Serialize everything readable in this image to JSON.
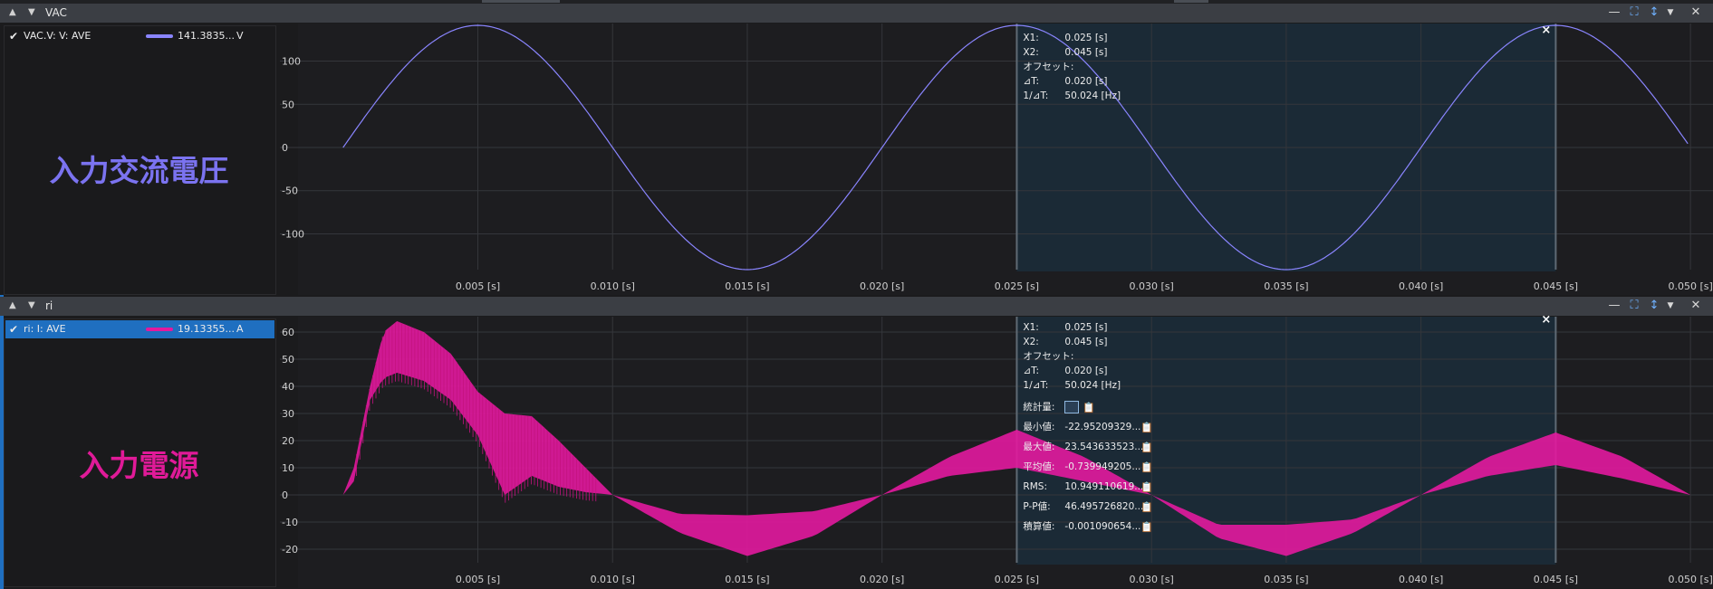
{
  "panels": [
    {
      "title": "VAC",
      "legend": {
        "name": "VAC.V: V: AVE",
        "value": "141.3835...",
        "unit": "V",
        "color": "#8a85ff",
        "selected": false
      },
      "annotation": {
        "text": "入力交流電圧",
        "color": "#7b73f0"
      },
      "cursor": {
        "close": "×",
        "rows": [
          {
            "label": "X1:",
            "value": "0.025 [s]"
          },
          {
            "label": "X2:",
            "value": "0.045 [s]"
          },
          {
            "label": "オフセット:",
            "value": ""
          },
          {
            "label": "⊿T:",
            "value": "0.020 [s]"
          },
          {
            "label": "1/⊿T:",
            "value": "50.024 [Hz]"
          }
        ]
      }
    },
    {
      "title": "ri",
      "legend": {
        "name": "ri: I: AVE",
        "value": "19.13355...",
        "unit": "A",
        "color": "#e3199e",
        "selected": true
      },
      "annotation": {
        "text": "入力電源",
        "color": "#e01a98"
      },
      "cursor": {
        "close": "×",
        "rows": [
          {
            "label": "X1:",
            "value": "0.025 [s]"
          },
          {
            "label": "X2:",
            "value": "0.045 [s]"
          },
          {
            "label": "オフセット:",
            "value": ""
          },
          {
            "label": "⊿T:",
            "value": "0.020 [s]"
          },
          {
            "label": "1/⊿T:",
            "value": "50.024 [Hz]"
          }
        ],
        "stats_label": "統計量:",
        "stats": [
          {
            "label": "最小値:",
            "value": "-22.95209329..."
          },
          {
            "label": "最大値:",
            "value": "23.543633523..."
          },
          {
            "label": "平均値:",
            "value": "-0.739949205..."
          },
          {
            "label": "RMS:",
            "value": "10.949110619..."
          },
          {
            "label": "P-P値:",
            "value": "46.495726820..."
          },
          {
            "label": "積算値:",
            "value": "-0.001090654..."
          }
        ]
      }
    }
  ],
  "chart_data": [
    {
      "type": "line",
      "series": [
        {
          "name": "VAC.V: V: AVE",
          "color": "#8a85ff"
        }
      ],
      "x": [
        0.0,
        0.0025,
        0.005,
        0.0075,
        0.01,
        0.0125,
        0.015,
        0.0175,
        0.02,
        0.0225,
        0.025,
        0.0275,
        0.03,
        0.0325,
        0.035,
        0.0375,
        0.04,
        0.0425,
        0.045,
        0.0475,
        0.05
      ],
      "y": [
        0,
        100,
        141.4,
        100,
        0,
        -100,
        -141.4,
        -100,
        0,
        100,
        141.4,
        100,
        0,
        -100,
        -141.4,
        -100,
        0,
        100,
        141.4,
        100,
        0
      ],
      "frequency_hz": 50,
      "amplitude": 141.4,
      "xlim": [
        -0.001,
        0.0505
      ],
      "ylim": [
        -141.4,
        141.4
      ],
      "xticks": [
        0.005,
        0.01,
        0.015,
        0.02,
        0.025,
        0.03,
        0.035,
        0.04,
        0.045,
        0.05
      ],
      "xtick_labels": [
        "0.005 [s]",
        "0.010 [s]",
        "0.015 [s]",
        "0.020 [s]",
        "0.025 [s]",
        "0.030 [s]",
        "0.035 [s]",
        "0.040 [s]",
        "0.045 [s]",
        "0.050 [s]"
      ],
      "yticks": [
        100,
        50,
        0,
        -50,
        -100
      ],
      "ytick_labels": [
        "100",
        "50",
        "0",
        "-50",
        "-100"
      ],
      "cursor_x": [
        0.025,
        0.045
      ],
      "grid": true
    },
    {
      "type": "area",
      "series": [
        {
          "name": "ri: I: AVE",
          "color": "#e3199e"
        }
      ],
      "envelope": {
        "t": [
          0.0,
          0.0004,
          0.001,
          0.0015,
          0.002,
          0.003,
          0.004,
          0.005,
          0.006,
          0.007,
          0.008,
          0.009,
          0.01,
          0.0125,
          0.015,
          0.0175,
          0.02,
          0.0225,
          0.025,
          0.0275,
          0.03,
          0.0325,
          0.035,
          0.0375,
          0.04,
          0.0425,
          0.045,
          0.0475,
          0.05
        ],
        "upper": [
          0,
          10,
          40,
          60,
          64,
          60,
          52,
          38,
          30,
          29,
          20,
          10,
          0,
          -7,
          -7.5,
          -6,
          0,
          14,
          24,
          14,
          0,
          -11,
          -11,
          -9,
          0,
          14,
          23,
          14,
          0
        ],
        "lower": [
          0,
          5,
          35,
          43,
          45,
          42,
          35,
          22,
          0,
          7,
          3,
          1,
          0,
          -14,
          -22.5,
          -15,
          0,
          7,
          10,
          5,
          0,
          -16,
          -22.5,
          -14,
          0,
          7,
          11,
          6,
          0
        ]
      },
      "xlim": [
        -0.001,
        0.0505
      ],
      "ylim": [
        -25,
        65
      ],
      "xticks": [
        0.005,
        0.01,
        0.015,
        0.02,
        0.025,
        0.03,
        0.035,
        0.04,
        0.045,
        0.05
      ],
      "xtick_labels": [
        "0.005 [s]",
        "0.010 [s]",
        "0.015 [s]",
        "0.020 [s]",
        "0.025 [s]",
        "0.030 [s]",
        "0.035 [s]",
        "0.040 [s]",
        "0.045 [s]",
        "0.050 [s]"
      ],
      "yticks": [
        60,
        50,
        40,
        30,
        20,
        10,
        0,
        -10,
        -20
      ],
      "ytick_labels": [
        "60",
        "50",
        "40",
        "30",
        "20",
        "10",
        "0",
        "-10",
        "-20"
      ],
      "cursor_x": [
        0.025,
        0.045
      ],
      "grid": true
    }
  ]
}
